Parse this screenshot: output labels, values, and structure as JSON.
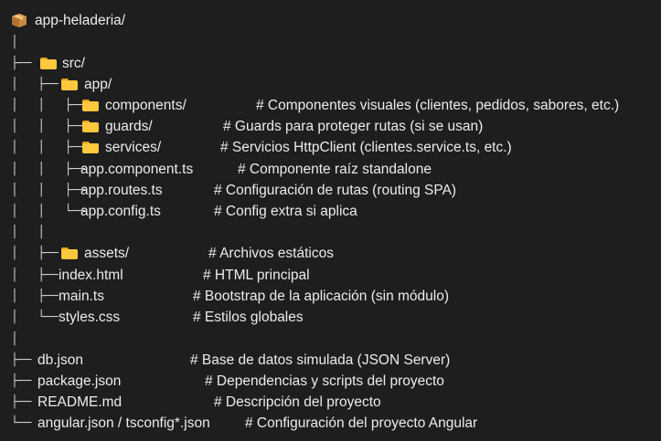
{
  "root": {
    "icon": "package-icon",
    "name": "app-heladeria/"
  },
  "tree": [
    {
      "prefix": "│"
    },
    {
      "prefix": "├── ",
      "icon": "folder-icon",
      "name": "src/"
    },
    {
      "prefix": "│   ├── ",
      "icon": "folder-icon",
      "name": "app/"
    },
    {
      "prefix": "│   │   ├── ",
      "icon": "folder-icon",
      "name": "components/",
      "comment": "# Componentes visuales (clientes, pedidos, sabores, etc.)"
    },
    {
      "prefix": "│   │   ├── ",
      "icon": "folder-icon",
      "name": "guards/",
      "comment": "# Guards para proteger rutas (si se usan)"
    },
    {
      "prefix": "│   │   ├── ",
      "icon": "folder-icon",
      "name": "services/",
      "comment": "# Servicios HttpClient (clientes.service.ts, etc.)"
    },
    {
      "prefix": "│   │   ├── ",
      "name": "app.component.ts",
      "comment": "# Componente raíz standalone"
    },
    {
      "prefix": "│   │   ├── ",
      "name": "app.routes.ts",
      "comment": "# Configuración de rutas (routing SPA)"
    },
    {
      "prefix": "│   │   └── ",
      "name": "app.config.ts",
      "comment": "# Config extra si aplica"
    },
    {
      "prefix": "│   │"
    },
    {
      "prefix": "│   ├── ",
      "icon": "folder-icon",
      "name": "assets/",
      "comment": "# Archivos estáticos"
    },
    {
      "prefix": "│   ├── ",
      "name": "index.html",
      "comment": "# HTML principal"
    },
    {
      "prefix": "│   ├── ",
      "name": "main.ts",
      "comment": "# Bootstrap de la aplicación (sin módulo)"
    },
    {
      "prefix": "│   └── ",
      "name": "styles.css",
      "comment": "# Estilos globales"
    },
    {
      "prefix": "│"
    },
    {
      "prefix": "├── ",
      "name": "db.json",
      "comment": "# Base de datos simulada (JSON Server)"
    },
    {
      "prefix": "├── ",
      "name": "package.json",
      "comment": "# Dependencias y scripts del proyecto"
    },
    {
      "prefix": "├── ",
      "name": "README.md",
      "comment": "# Descripción del proyecto"
    },
    {
      "prefix": "└── ",
      "name": "angular.json / tsconfig*.json",
      "comment": "# Configuración del proyecto Angular"
    }
  ]
}
